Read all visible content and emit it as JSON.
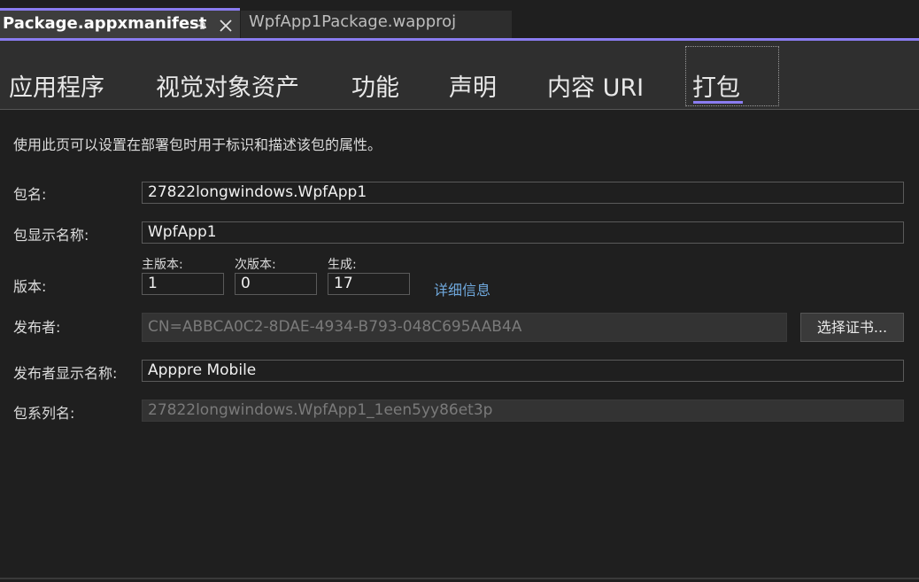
{
  "document_tabs": {
    "active": {
      "title": "Package.appxmanifest",
      "pin_icon": "pin-icon",
      "close_icon": "close-icon"
    },
    "inactive": {
      "title": "WpfApp1Package.wapproj"
    }
  },
  "section_tabs": [
    {
      "label": "应用程序"
    },
    {
      "label": "视觉对象资产"
    },
    {
      "label": "功能"
    },
    {
      "label": "声明"
    },
    {
      "label": "内容 URI"
    },
    {
      "label": "打包",
      "selected": true
    }
  ],
  "description": "使用此页可以设置在部署包时用于标识和描述该包的属性。",
  "form": {
    "package_name": {
      "label": "包名:",
      "value": "27822longwindows.WpfApp1"
    },
    "display_name": {
      "label": "包显示名称:",
      "value": "WpfApp1"
    },
    "version": {
      "label": "版本:",
      "major_label": "主版本:",
      "major": "1",
      "minor_label": "次版本:",
      "minor": "0",
      "build_label": "生成:",
      "build": "17",
      "details_link": "详细信息"
    },
    "publisher": {
      "label": "发布者:",
      "value": "CN=ABBCA0C2-8DAE-4934-B793-048C695AAB4A",
      "button": "选择证书..."
    },
    "publisher_display_name": {
      "label": "发布者显示名称:",
      "value": "Apppre Mobile"
    },
    "family_name": {
      "label": "包系列名:",
      "value": "27822longwindows.WpfApp1_1een5yy86et3p"
    }
  },
  "colors": {
    "accent": "#8a7cf0",
    "link": "#6fa8dc",
    "background": "#1f1f1f"
  }
}
